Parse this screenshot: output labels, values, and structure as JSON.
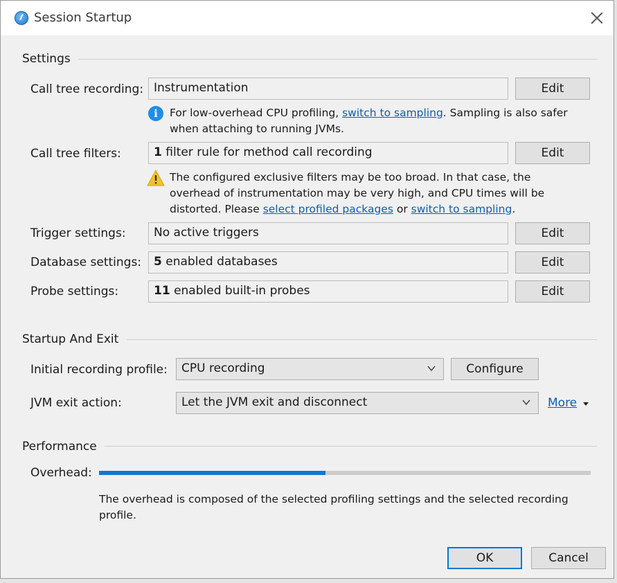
{
  "window": {
    "title": "Session Startup"
  },
  "settings": {
    "heading": "Settings",
    "call_tree_recording": {
      "label": "Call tree recording:",
      "value": "Instrumentation",
      "edit_label": "Edit",
      "info": {
        "text_before": "For low-overhead CPU profiling, ",
        "link": "switch to sampling",
        "text_after": ". Sampling is also safer when attaching to running JVMs."
      }
    },
    "call_tree_filters": {
      "label": "Call tree filters:",
      "count": "1",
      "value_rest": " filter rule for method call recording",
      "edit_label": "Edit",
      "warning": {
        "text_before": "The configured exclusive filters may be too broad. In that case, the overhead of instrumentation may be very high, and CPU times will be distorted. Please ",
        "link1": "select profiled packages",
        "text_mid": " or ",
        "link2": "switch to sampling",
        "text_after": "."
      }
    },
    "trigger_settings": {
      "label": "Trigger settings:",
      "value": "No active triggers",
      "edit_label": "Edit"
    },
    "database_settings": {
      "label": "Database settings:",
      "count": "5",
      "value_rest": " enabled databases",
      "edit_label": "Edit"
    },
    "probe_settings": {
      "label": "Probe settings:",
      "count": "11",
      "value_rest": " enabled built-in probes",
      "edit_label": "Edit"
    }
  },
  "startup_exit": {
    "heading": "Startup And Exit",
    "initial_profile": {
      "label": "Initial recording profile:",
      "selected": "CPU recording",
      "configure_label": "Configure"
    },
    "jvm_exit": {
      "label": "JVM exit action:",
      "selected": "Let the JVM exit and disconnect",
      "more_label": "More"
    }
  },
  "performance": {
    "heading": "Performance",
    "overhead_label": "Overhead:",
    "overhead_level": 0.46,
    "description": "The overhead is composed of the selected profiling settings and the selected recording profile."
  },
  "footer": {
    "ok_label": "OK",
    "cancel_label": "Cancel"
  },
  "colors": {
    "accent": "#1476d1",
    "link": "#0b5fb3",
    "info_icon": "#1e8ee6",
    "warning_icon": "#f2c12e"
  },
  "icons": {
    "title": "profiler-app-icon",
    "close": "close-icon",
    "info": "info-icon",
    "warning": "warning-icon",
    "dropdown": "chevron-down-icon",
    "more": "triangle-down-icon"
  }
}
